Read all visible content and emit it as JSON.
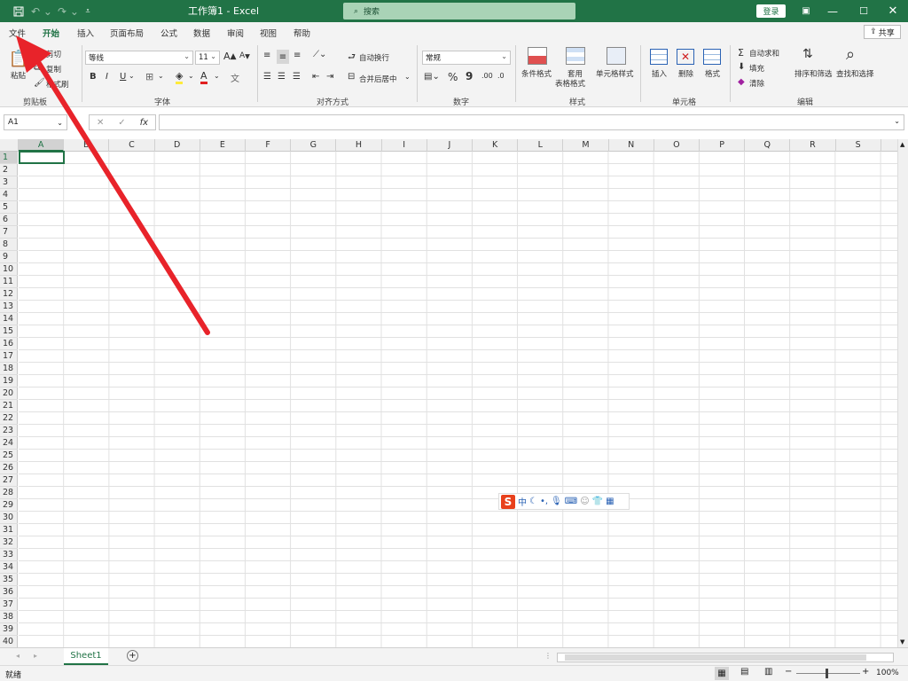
{
  "titlebar": {
    "doc_title": "工作簿1 - Excel",
    "search_placeholder": "搜索",
    "login_label": "登录"
  },
  "tabs": [
    {
      "label": "文件"
    },
    {
      "label": "开始"
    },
    {
      "label": "插入"
    },
    {
      "label": "页面布局"
    },
    {
      "label": "公式"
    },
    {
      "label": "数据"
    },
    {
      "label": "审阅"
    },
    {
      "label": "视图"
    },
    {
      "label": "帮助"
    }
  ],
  "share_label": "共享",
  "ribbon": {
    "clipboard": {
      "paste": "粘贴",
      "cut": "剪切",
      "copy": "复制",
      "format_painter": "格式刷",
      "label": "剪贴板"
    },
    "font": {
      "name": "等线",
      "size": "11",
      "bold": "B",
      "italic": "I",
      "underline": "U",
      "label": "字体",
      "grow": "A",
      "shrink": "A"
    },
    "alignment": {
      "wrap": "自动换行",
      "merge": "合并后居中",
      "label": "对齐方式"
    },
    "number": {
      "format": "常规",
      "percent": "%",
      "comma": "9",
      "label": "数字"
    },
    "styles": {
      "conditional": "条件格式",
      "table_line1": "套用",
      "table_line2": "表格格式",
      "cell_styles": "单元格样式",
      "label": "样式"
    },
    "cells": {
      "insert": "插入",
      "delete": "删除",
      "format": "格式",
      "label": "单元格"
    },
    "editing": {
      "autosum": "自动求和",
      "fill": "填充",
      "clear": "清除",
      "sort": "排序和筛选",
      "find": "查找和选择",
      "label": "编辑"
    }
  },
  "formula_bar": {
    "name_box": "A1",
    "fx": "fx"
  },
  "columns": [
    "A",
    "B",
    "C",
    "D",
    "E",
    "F",
    "G",
    "H",
    "I",
    "J",
    "K",
    "L",
    "M",
    "N",
    "O",
    "P",
    "Q",
    "R",
    "S"
  ],
  "rows": [
    "1",
    "2",
    "3",
    "4",
    "5",
    "6",
    "7",
    "8",
    "9",
    "10",
    "11",
    "12",
    "13",
    "14",
    "15",
    "16",
    "17",
    "18",
    "19",
    "20",
    "21",
    "22",
    "23",
    "24",
    "25",
    "26",
    "27",
    "28",
    "29",
    "30",
    "31",
    "32",
    "33",
    "34",
    "35",
    "36",
    "37",
    "38",
    "39",
    "40"
  ],
  "sheet": {
    "tab": "Sheet1",
    "add": "+"
  },
  "status": {
    "ready": "就绪",
    "zoom": "100%"
  },
  "ime": {
    "logo": "S",
    "mode": "中"
  },
  "colors": {
    "accent": "#217346",
    "arrow": "#e8232a"
  }
}
